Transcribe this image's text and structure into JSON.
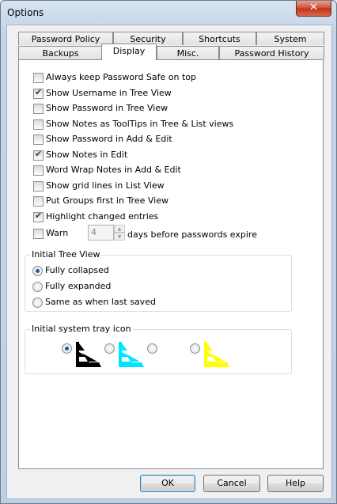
{
  "window": {
    "title": "Options",
    "close_glyph": "✕"
  },
  "tabs_back": [
    "Password Policy",
    "Security",
    "Shortcuts",
    "System"
  ],
  "tabs_front": [
    "Backups",
    "Display",
    "Misc.",
    "Password History"
  ],
  "active_tab": "Display",
  "checkboxes": [
    {
      "label": "Always keep Password Safe on top",
      "checked": false
    },
    {
      "label": "Show Username in Tree View",
      "checked": true
    },
    {
      "label": "Show Password in Tree View",
      "checked": false
    },
    {
      "label": "Show Notes as ToolTips in Tree & List views",
      "checked": false
    },
    {
      "label": "Show Password in Add & Edit",
      "checked": false
    },
    {
      "label": "Show Notes in Edit",
      "checked": true
    },
    {
      "label": "Word Wrap Notes in Add & Edit",
      "checked": false
    },
    {
      "label": "Show grid lines in List View",
      "checked": false
    },
    {
      "label": "Put Groups first in Tree View",
      "checked": false
    },
    {
      "label": "Highlight changed entries",
      "checked": true
    }
  ],
  "warn": {
    "label": "Warn",
    "checked": false,
    "days_value": "4",
    "suffix": "days before passwords expire"
  },
  "initial_tree_view": {
    "title": "Initial Tree View",
    "options": [
      {
        "label": "Fully collapsed",
        "selected": true
      },
      {
        "label": "Fully expanded",
        "selected": false
      },
      {
        "label": "Same as when last saved",
        "selected": false
      }
    ]
  },
  "tray_icon": {
    "title": "Initial system tray icon",
    "options": [
      {
        "icon": "black-tray-icon",
        "color": "#000000",
        "selected": true
      },
      {
        "icon": "cyan-tray-icon",
        "color": "#00e5ff",
        "selected": false
      },
      {
        "icon": "white-tray-icon",
        "color": "#ffffff",
        "selected": false
      },
      {
        "icon": "yellow-tray-icon",
        "color": "#ffff00",
        "selected": false
      }
    ]
  },
  "buttons": {
    "ok": "OK",
    "cancel": "Cancel",
    "help": "Help"
  }
}
